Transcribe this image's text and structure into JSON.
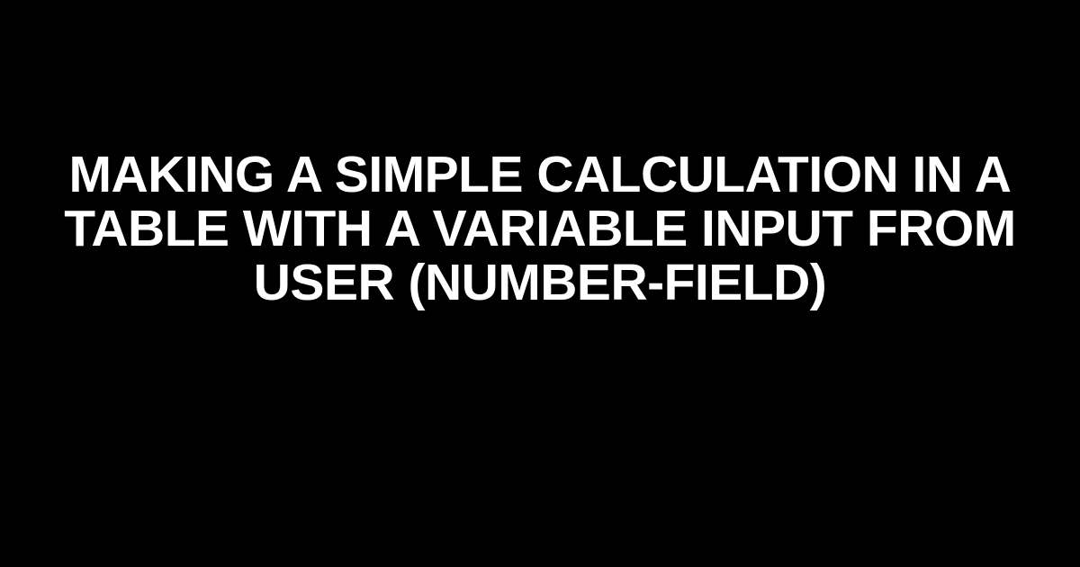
{
  "title": "Making a Simple Calculation in a Table with a Variable Input from User (Number-Field)"
}
